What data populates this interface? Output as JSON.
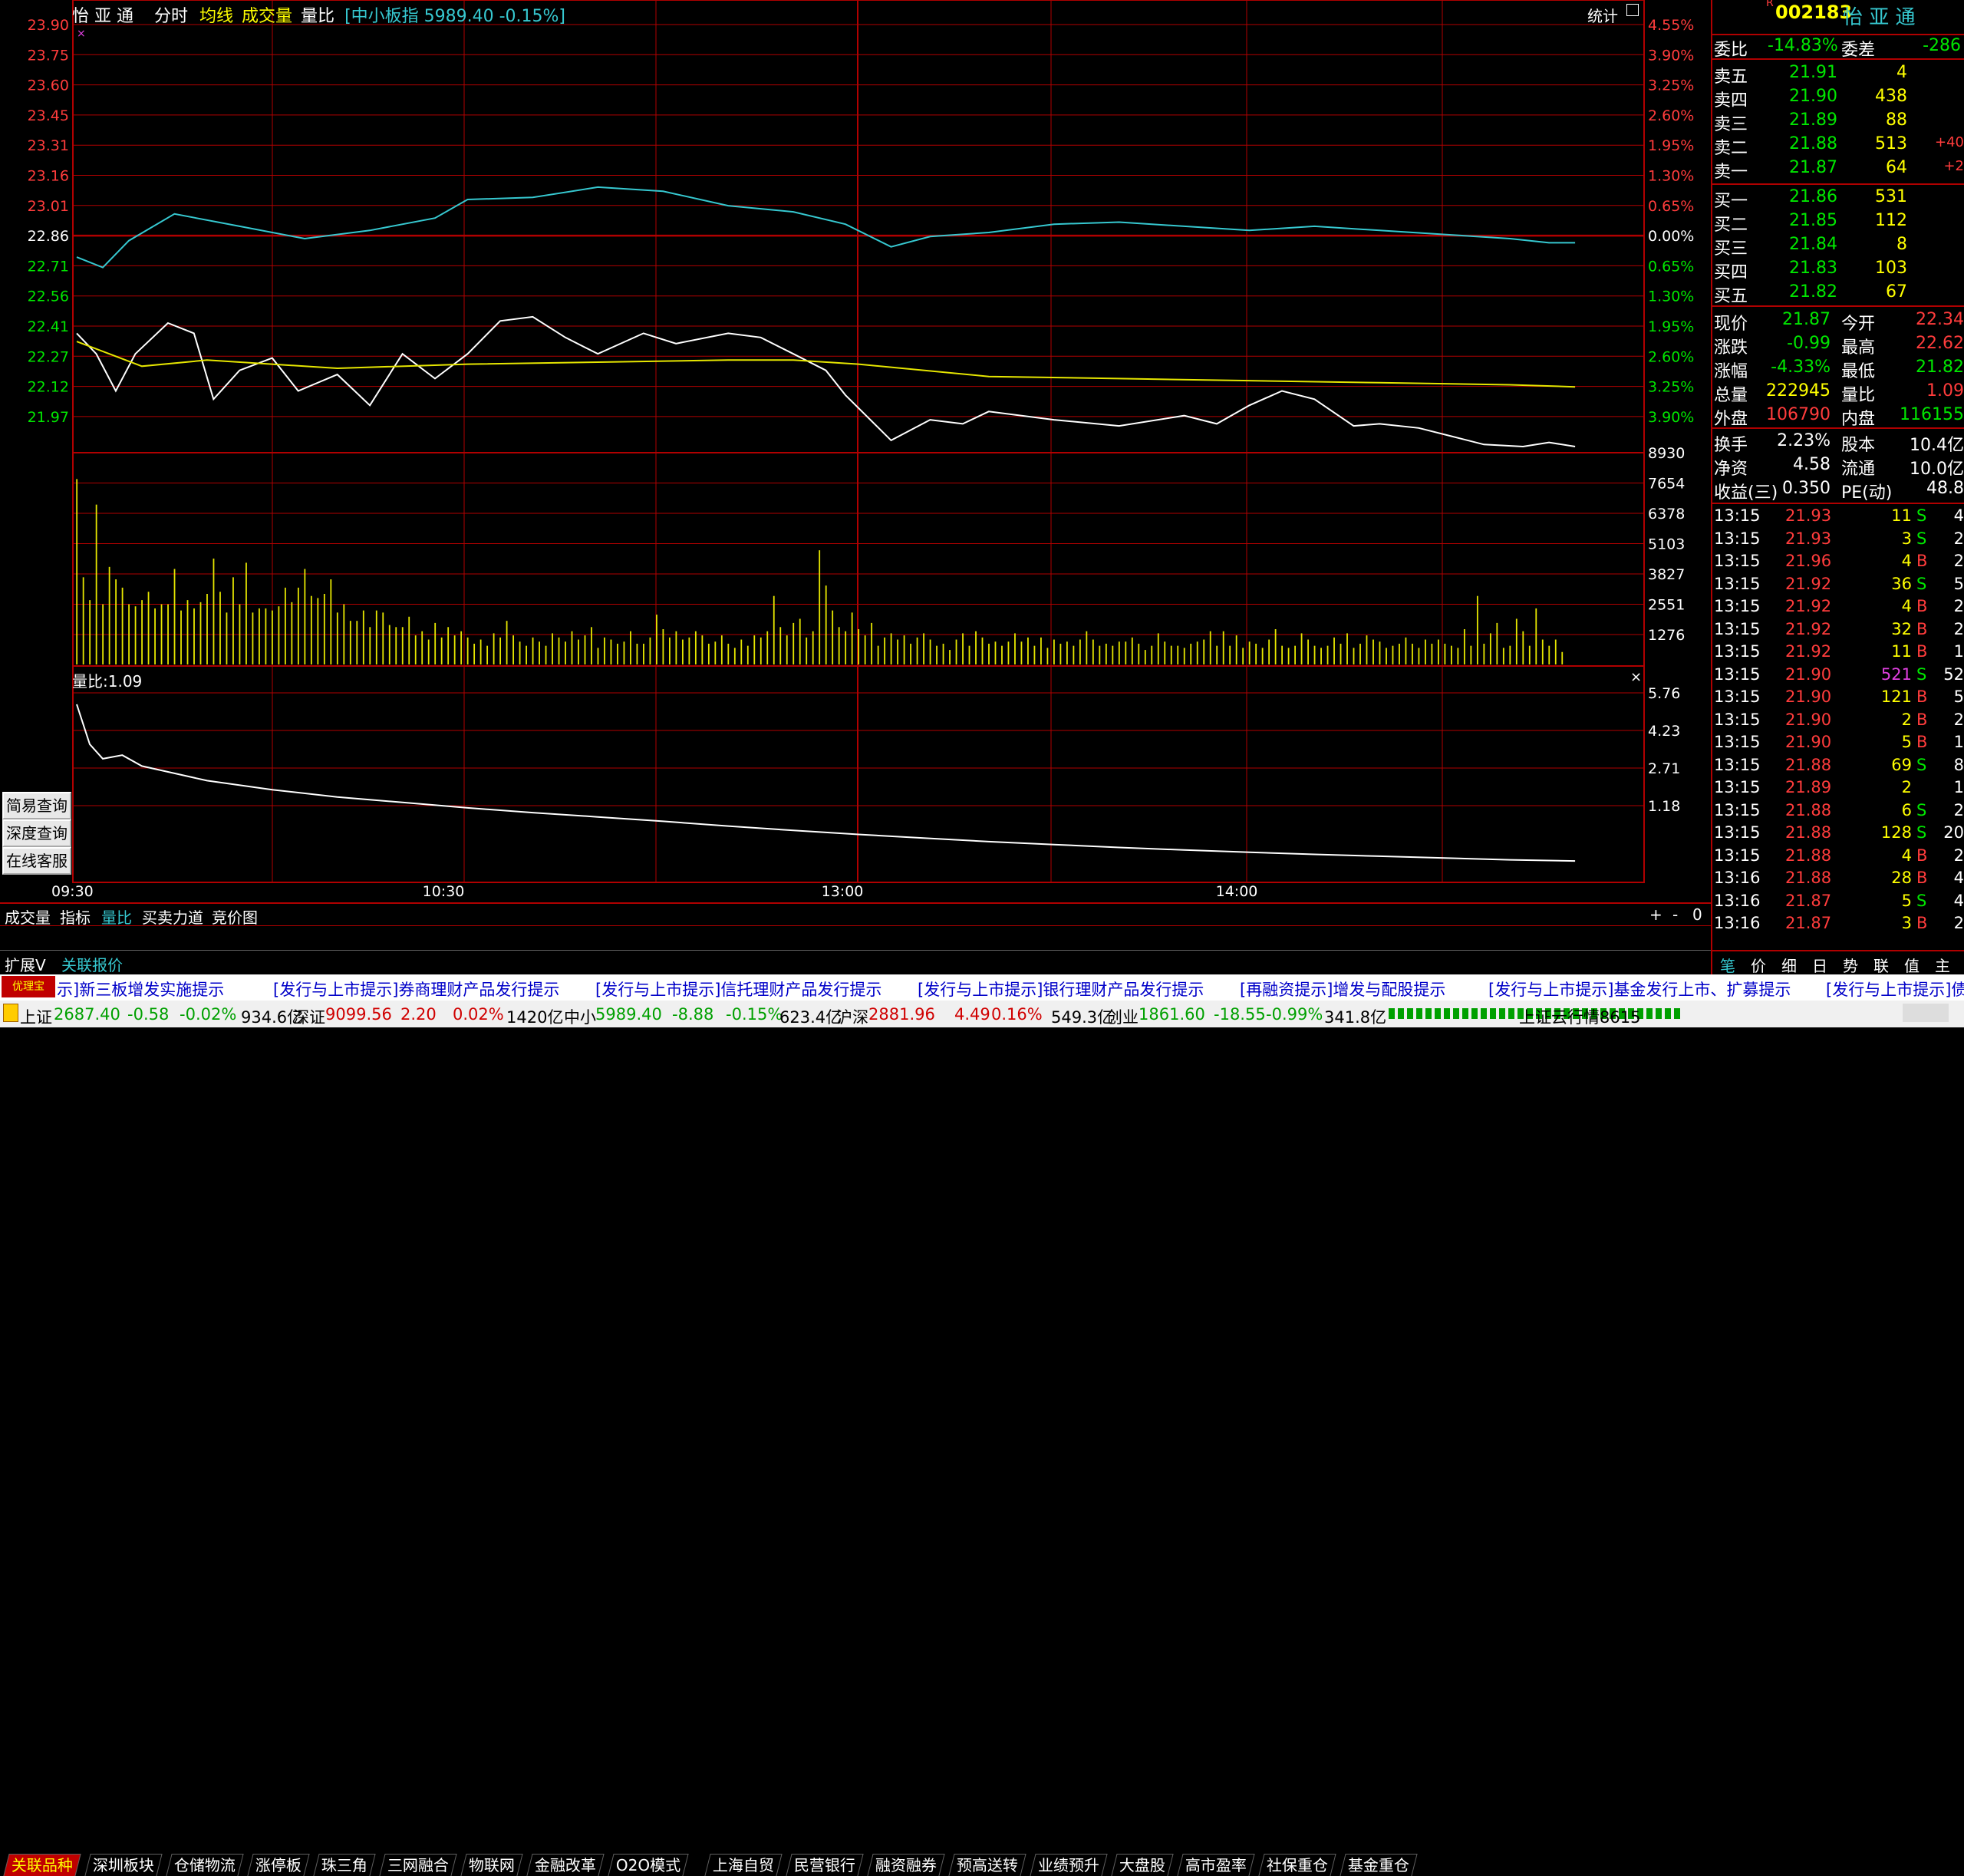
{
  "header": {
    "stock_name": "怡 亚 通",
    "mode": "分时",
    "avg_line_label": "均线",
    "volume_label": "成交量",
    "vol_ratio_label": "量比",
    "index_info": "[中小板指 5989.40 -0.15%]",
    "stats_label": "统计",
    "close_x": "×"
  },
  "quote": {
    "code": "002183",
    "name": "怡 亚 通",
    "r_mark": "R",
    "weibi_label": "委比",
    "weibi": "-14.83%",
    "weicha_label": "委差",
    "weicha": "-286",
    "sells": [
      {
        "label": "卖五",
        "price": "21.91",
        "vol": "4",
        "chg": ""
      },
      {
        "label": "卖四",
        "price": "21.90",
        "vol": "438",
        "chg": ""
      },
      {
        "label": "卖三",
        "price": "21.89",
        "vol": "88",
        "chg": ""
      },
      {
        "label": "卖二",
        "price": "21.88",
        "vol": "513",
        "chg": "+40"
      },
      {
        "label": "卖一",
        "price": "21.87",
        "vol": "64",
        "chg": "+2"
      }
    ],
    "buys": [
      {
        "label": "买一",
        "price": "21.86",
        "vol": "531"
      },
      {
        "label": "买二",
        "price": "21.85",
        "vol": "112"
      },
      {
        "label": "买三",
        "price": "21.84",
        "vol": "8"
      },
      {
        "label": "买四",
        "price": "21.83",
        "vol": "103"
      },
      {
        "label": "买五",
        "price": "21.82",
        "vol": "67"
      }
    ],
    "stats": [
      {
        "l1": "现价",
        "v1": "21.87",
        "l2": "今开",
        "v2": "22.34"
      },
      {
        "l1": "涨跌",
        "v1": "-0.99",
        "l2": "最高",
        "v2": "22.62"
      },
      {
        "l1": "涨幅",
        "v1": "-4.33%",
        "l2": "最低",
        "v2": "21.82"
      },
      {
        "l1": "总量",
        "v1": "222945",
        "l2": "量比",
        "v2": "1.09"
      },
      {
        "l1": "外盘",
        "v1": "106790",
        "l2": "内盘",
        "v2": "116155"
      }
    ],
    "stats2": [
      {
        "l1": "换手",
        "v1": "2.23%",
        "l2": "股本",
        "v2": "10.4亿"
      },
      {
        "l1": "净资",
        "v1": "4.58",
        "l2": "流通",
        "v2": "10.0亿"
      },
      {
        "l1": "收益(三)",
        "v1": "0.350",
        "l2": "PE(动)",
        "v2": "48.8"
      }
    ]
  },
  "trades": [
    {
      "t": "13:15",
      "p": "21.93",
      "v": "11",
      "s": "S",
      "n": "4"
    },
    {
      "t": "13:15",
      "p": "21.93",
      "v": "3",
      "s": "S",
      "n": "2"
    },
    {
      "t": "13:15",
      "p": "21.96",
      "v": "4",
      "s": "B",
      "n": "2"
    },
    {
      "t": "13:15",
      "p": "21.92",
      "v": "36",
      "s": "S",
      "n": "5"
    },
    {
      "t": "13:15",
      "p": "21.92",
      "v": "4",
      "s": "B",
      "n": "2"
    },
    {
      "t": "13:15",
      "p": "21.92",
      "v": "32",
      "s": "B",
      "n": "2"
    },
    {
      "t": "13:15",
      "p": "21.92",
      "v": "11",
      "s": "B",
      "n": "1"
    },
    {
      "t": "13:15",
      "p": "21.90",
      "v": "521",
      "s": "S",
      "n": "52"
    },
    {
      "t": "13:15",
      "p": "21.90",
      "v": "121",
      "s": "B",
      "n": "5"
    },
    {
      "t": "13:15",
      "p": "21.90",
      "v": "2",
      "s": "B",
      "n": "2"
    },
    {
      "t": "13:15",
      "p": "21.90",
      "v": "5",
      "s": "B",
      "n": "1"
    },
    {
      "t": "13:15",
      "p": "21.88",
      "v": "69",
      "s": "S",
      "n": "8"
    },
    {
      "t": "13:15",
      "p": "21.89",
      "v": "2",
      "s": "",
      "n": "1"
    },
    {
      "t": "13:15",
      "p": "21.88",
      "v": "6",
      "s": "S",
      "n": "2"
    },
    {
      "t": "13:15",
      "p": "21.88",
      "v": "128",
      "s": "S",
      "n": "20"
    },
    {
      "t": "13:15",
      "p": "21.88",
      "v": "4",
      "s": "B",
      "n": "2"
    },
    {
      "t": "13:16",
      "p": "21.88",
      "v": "28",
      "s": "B",
      "n": "4"
    },
    {
      "t": "13:16",
      "p": "21.87",
      "v": "5",
      "s": "S",
      "n": "4"
    },
    {
      "t": "13:16",
      "p": "21.87",
      "v": "3",
      "s": "B",
      "n": "2"
    }
  ],
  "right_tabs": [
    "笔",
    "价",
    "细",
    "日",
    "势",
    "联",
    "值",
    "主"
  ],
  "price_axis": {
    "left": [
      "23.90",
      "23.75",
      "23.60",
      "23.45",
      "23.31",
      "23.16",
      "23.01",
      "22.86",
      "22.71",
      "22.56",
      "22.41",
      "22.27",
      "22.12",
      "21.97"
    ],
    "right": [
      "4.55%",
      "3.90%",
      "3.25%",
      "2.60%",
      "1.95%",
      "1.30%",
      "0.65%",
      "0.00%",
      "0.65%",
      "1.30%",
      "1.95%",
      "2.60%",
      "3.25%",
      "3.90%"
    ]
  },
  "volume_axis": [
    "8930",
    "7654",
    "6378",
    "5103",
    "3827",
    "2551",
    "1276"
  ],
  "ratio_axis": [
    "5.76",
    "4.23",
    "2.71",
    "1.18"
  ],
  "ratio_label": "量比:1.09",
  "time_axis": [
    "09:30",
    "10:30",
    "13:00",
    "14:00"
  ],
  "left_buttons": [
    "简易查询",
    "深度查询",
    "在线客服"
  ],
  "indicator_tabs": [
    "成交量",
    "指标",
    "量比",
    "买卖力道",
    "竞价图"
  ],
  "zoom_controls": [
    "+",
    "-",
    "0"
  ],
  "sector_tabs": [
    "关联品种",
    "深圳板块",
    "仓储物流",
    "涨停板",
    "珠三角",
    "三网融合",
    "物联网",
    "金融改革",
    "O2O模式",
    "上海自贸",
    "民营银行",
    "融资融券",
    "预高送转",
    "业绩预升",
    "大盘股",
    "高市盈率",
    "社保重仓",
    "基金重仓"
  ],
  "footer_left": [
    "扩展V",
    "关联报价"
  ],
  "ticker": [
    "示]新三板增发实施提示",
    "[发行与上市提示]券商理财产品发行提示",
    "[发行与上市提示]信托理财产品发行提示",
    "[发行与上市提示]银行理财产品发行提示",
    "[再融资提示]增发与配股提示",
    "[发行与上市提示]基金发行上市、扩募提示",
    "[发行与上市提示]债"
  ],
  "ticker_logo": "优理宝",
  "status": {
    "sh_label": "上证",
    "sh_val": "2687.40",
    "sh_chg": "-0.58",
    "sh_pct": "-0.02%",
    "sh_amt": "934.6亿",
    "sz_label": "深证",
    "sz_val": "9099.56",
    "sz_chg": "2.20",
    "sz_pct": "0.02%",
    "sz_amt": "1420亿",
    "zx_label": "中小",
    "zx_val": "5989.40",
    "zx_chg": "-8.88",
    "zx_pct": "-0.15%",
    "zx_amt": "623.4亿",
    "hs_label": "沪深",
    "hs_val": "2881.96",
    "hs_chg": "4.49",
    "hs_pct": "0.16%",
    "hs_amt": "549.3亿",
    "cy_label": "创业",
    "cy_val": "1861.60",
    "cy_chg": "-18.55",
    "cy_pct": "-0.99%",
    "cy_amt": "341.8亿",
    "cloud": "上证云行情8615"
  },
  "chart_data": [
    {
      "type": "line",
      "name_ref": "intraday-price",
      "x_unit": "minutes since 09:30 (trading minutes, 240 total)",
      "ylim": [
        21.82,
        23.9
      ],
      "prev_close": 22.86,
      "series": [
        {
          "name": "价格",
          "color": "#ffffff",
          "x": [
            0,
            3,
            6,
            9,
            14,
            18,
            21,
            25,
            30,
            34,
            40,
            45,
            50,
            55,
            60,
            65,
            70,
            75,
            80,
            87,
            92,
            100,
            105,
            110,
            115,
            118,
            125,
            131,
            136,
            140,
            150,
            160,
            170,
            175,
            180,
            185,
            190,
            196,
            200,
            206,
            211,
            216,
            222,
            226,
            230
          ],
          "y": [
            22.4,
            22.3,
            22.12,
            22.3,
            22.45,
            22.4,
            22.08,
            22.22,
            22.28,
            22.12,
            22.2,
            22.05,
            22.3,
            22.18,
            22.3,
            22.46,
            22.48,
            22.38,
            22.3,
            22.4,
            22.35,
            22.4,
            22.38,
            22.3,
            22.22,
            22.1,
            21.88,
            21.98,
            21.96,
            22.02,
            21.98,
            21.95,
            22.0,
            21.96,
            22.05,
            22.12,
            22.08,
            21.95,
            21.96,
            21.94,
            21.9,
            21.86,
            21.85,
            21.87,
            21.85
          ]
        },
        {
          "name": "均价",
          "color": "#e6e600",
          "x": [
            0,
            5,
            10,
            20,
            40,
            60,
            80,
            100,
            110,
            120,
            140,
            160,
            180,
            200,
            220,
            230
          ],
          "y": [
            22.36,
            22.3,
            22.24,
            22.27,
            22.23,
            22.25,
            22.26,
            22.27,
            22.27,
            22.25,
            22.19,
            22.18,
            22.17,
            22.16,
            22.15,
            22.14
          ]
        },
        {
          "name": "中小板指",
          "color": "#36c8d0",
          "x": [
            0,
            4,
            8,
            15,
            25,
            35,
            45,
            55,
            60,
            70,
            80,
            90,
            100,
            110,
            118,
            125,
            131,
            140,
            150,
            160,
            170,
            180,
            190,
            200,
            210,
            220,
            226,
            230
          ],
          "y": [
            22.77,
            22.72,
            22.85,
            22.98,
            22.92,
            22.86,
            22.9,
            22.96,
            23.05,
            23.06,
            23.11,
            23.09,
            23.02,
            22.99,
            22.93,
            22.82,
            22.87,
            22.89,
            22.93,
            22.94,
            22.92,
            22.9,
            22.92,
            22.9,
            22.88,
            22.86,
            22.84,
            22.84
          ]
        }
      ]
    },
    {
      "type": "bar",
      "name_ref": "intraday-volume",
      "ylim": [
        0,
        10200
      ],
      "series": [
        {
          "name": "成交量",
          "color": "#e6e600",
          "values": [
            8930,
            4200,
            3100,
            7700,
            2900,
            4700,
            4100,
            3700,
            2900,
            2800,
            3100,
            3500,
            2700,
            2900,
            2900,
            4600,
            2600,
            3100,
            2700,
            3000,
            3400,
            5100,
            3500,
            2500,
            4200,
            2900,
            4900,
            2500,
            2700,
            2700,
            2600,
            2800,
            3700,
            3000,
            3700,
            4600,
            3300,
            3200,
            3400,
            4100,
            2500,
            2900,
            2100,
            2100,
            2600,
            1800,
            2600,
            2500,
            1900,
            1800,
            1800,
            2300,
            1400,
            1600,
            1200,
            2000,
            1300,
            1800,
            1400,
            1600,
            1300,
            1000,
            1200,
            900,
            1500,
            1300,
            2100,
            1400,
            1100,
            900,
            1300,
            1100,
            900,
            1500,
            1300,
            1100,
            1600,
            1200,
            1400,
            1800,
            800,
            1300,
            1200,
            1000,
            1100,
            1600,
            1000,
            1000,
            1300,
            2400,
            1700,
            1300,
            1600,
            1200,
            1300,
            1600,
            1400,
            1000,
            1100,
            1400,
            1000,
            800,
            1200,
            900,
            1400,
            1300,
            1600,
            3300,
            1800,
            1400,
            2000,
            2200,
            1300,
            1600,
            5500,
            3800,
            2600,
            1800,
            1600,
            2500,
            1700,
            1400,
            2000,
            900,
            1300,
            1500,
            1200,
            1400,
            1000,
            1300,
            1500,
            1200,
            900,
            1000,
            700,
            1200,
            1500,
            900,
            1600,
            1300,
            1000,
            1100,
            900,
            1100,
            1500,
            1100,
            1300,
            900,
            1300,
            800,
            1200,
            1000,
            1100,
            900,
            1200,
            1600,
            1200,
            900,
            1000,
            900,
            1100,
            1100,
            1300,
            1000,
            700,
            900,
            1500,
            1100,
            900,
            900,
            800,
            1000,
            1100,
            1200,
            1600,
            900,
            1600,
            900,
            1400,
            800,
            1100,
            1000,
            800,
            1200,
            1700,
            900,
            800,
            900,
            1500,
            1200,
            900,
            800,
            900,
            1300,
            1000,
            1500,
            800,
            1000,
            1400,
            1200,
            1100,
            800,
            900,
            1000,
            1300,
            1000,
            800,
            1200,
            1000,
            1200,
            1000,
            900,
            800,
            1700,
            900,
            3300,
            1000,
            1500,
            2000,
            800,
            900,
            2200,
            1600,
            900,
            2700,
            1200,
            900,
            1200,
            600
          ]
        }
      ]
    },
    {
      "type": "line",
      "name_ref": "volume-ratio",
      "ylim": [
        0.5,
        6.2
      ],
      "series": [
        {
          "name": "量比",
          "color": "#ffffff",
          "x": [
            0,
            2,
            4,
            7,
            10,
            15,
            20,
            30,
            40,
            50,
            60,
            70,
            80,
            90,
            100,
            110,
            120,
            130,
            140,
            150,
            160,
            170,
            180,
            190,
            200,
            210,
            220,
            230
          ],
          "y": [
            5.4,
            4.3,
            3.9,
            4.0,
            3.7,
            3.5,
            3.3,
            3.05,
            2.85,
            2.7,
            2.55,
            2.42,
            2.3,
            2.18,
            2.05,
            1.93,
            1.82,
            1.72,
            1.62,
            1.54,
            1.46,
            1.39,
            1.33,
            1.27,
            1.22,
            1.17,
            1.12,
            1.09
          ]
        }
      ]
    }
  ],
  "colors": {
    "up": "#ff3c3c",
    "down": "#00e600",
    "frame": "#b00000",
    "accent": "#ffff00",
    "cyan": "#36c8d0"
  }
}
